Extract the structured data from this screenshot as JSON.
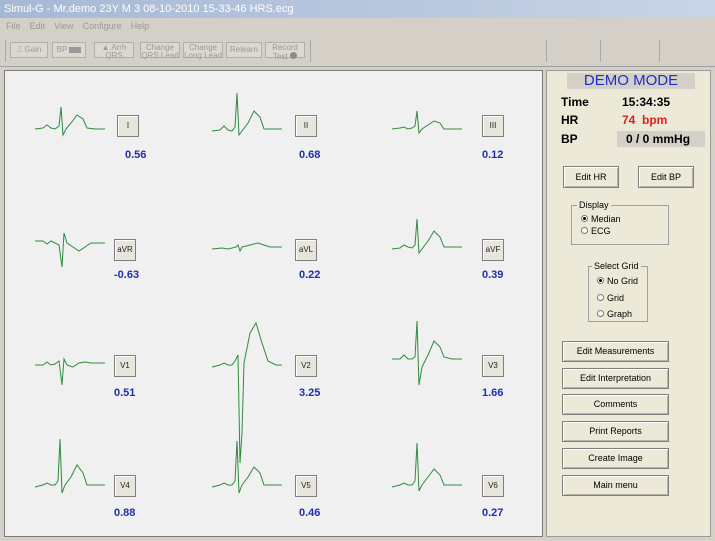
{
  "window": {
    "title": "Simul-G - Mr.demo 23Y M 3 08-10-2010 15-33-46 HRS.ecg"
  },
  "menu": [
    "File",
    "Edit",
    "View",
    "Configure",
    "Help"
  ],
  "toolbar": {
    "gain": "Gain",
    "bp": "BP",
    "arrh_line1": "Arrh",
    "arrh_line2": "QRS",
    "change_qrs_line1": "Change",
    "change_qrs_line2": "QRS Lead",
    "change_long_line1": "Change",
    "change_long_line2": "Long Lead",
    "relearn": "Relearn",
    "record_line1": "Record",
    "record_line2": "Test"
  },
  "leads": [
    {
      "name": "I",
      "value": "0.56"
    },
    {
      "name": "II",
      "value": "0.68"
    },
    {
      "name": "III",
      "value": "0.12"
    },
    {
      "name": "aVR",
      "value": "-0.63"
    },
    {
      "name": "aVL",
      "value": "0.22"
    },
    {
      "name": "aVF",
      "value": "0.39"
    },
    {
      "name": "V1",
      "value": "0.51"
    },
    {
      "name": "V2",
      "value": "3.25"
    },
    {
      "name": "V3",
      "value": "1.66"
    },
    {
      "name": "V4",
      "value": "0.88"
    },
    {
      "name": "V5",
      "value": "0.46"
    },
    {
      "name": "V6",
      "value": "0.27"
    }
  ],
  "status": {
    "mode": "DEMO MODE",
    "time_label": "Time",
    "time_value": "15:34:35",
    "hr_label": "HR",
    "hr_value": "74  bpm",
    "bp_label": "BP",
    "bp_value": "0 / 0 mmHg"
  },
  "buttons": {
    "edit_hr": "Edit HR",
    "edit_bp": "Edit BP",
    "edit_measurements": "Edit Measurements",
    "edit_interpretation": "Edit Interpretation",
    "comments": "Comments",
    "print_reports": "Print Reports",
    "create_image": "Create Image",
    "main_menu": "Main menu"
  },
  "display_group": {
    "label": "Display",
    "options": [
      "Median",
      "ECG"
    ],
    "selected": "Median"
  },
  "grid_group": {
    "label": "Select Grid",
    "options": [
      "No Grid",
      "Grid",
      "Graph"
    ],
    "selected": "No Grid"
  },
  "colors": {
    "trace": "#2e8b3e",
    "value_text": "#1e2fb0",
    "hr_text": "#e02020",
    "mode_text": "#1c2fc8"
  }
}
